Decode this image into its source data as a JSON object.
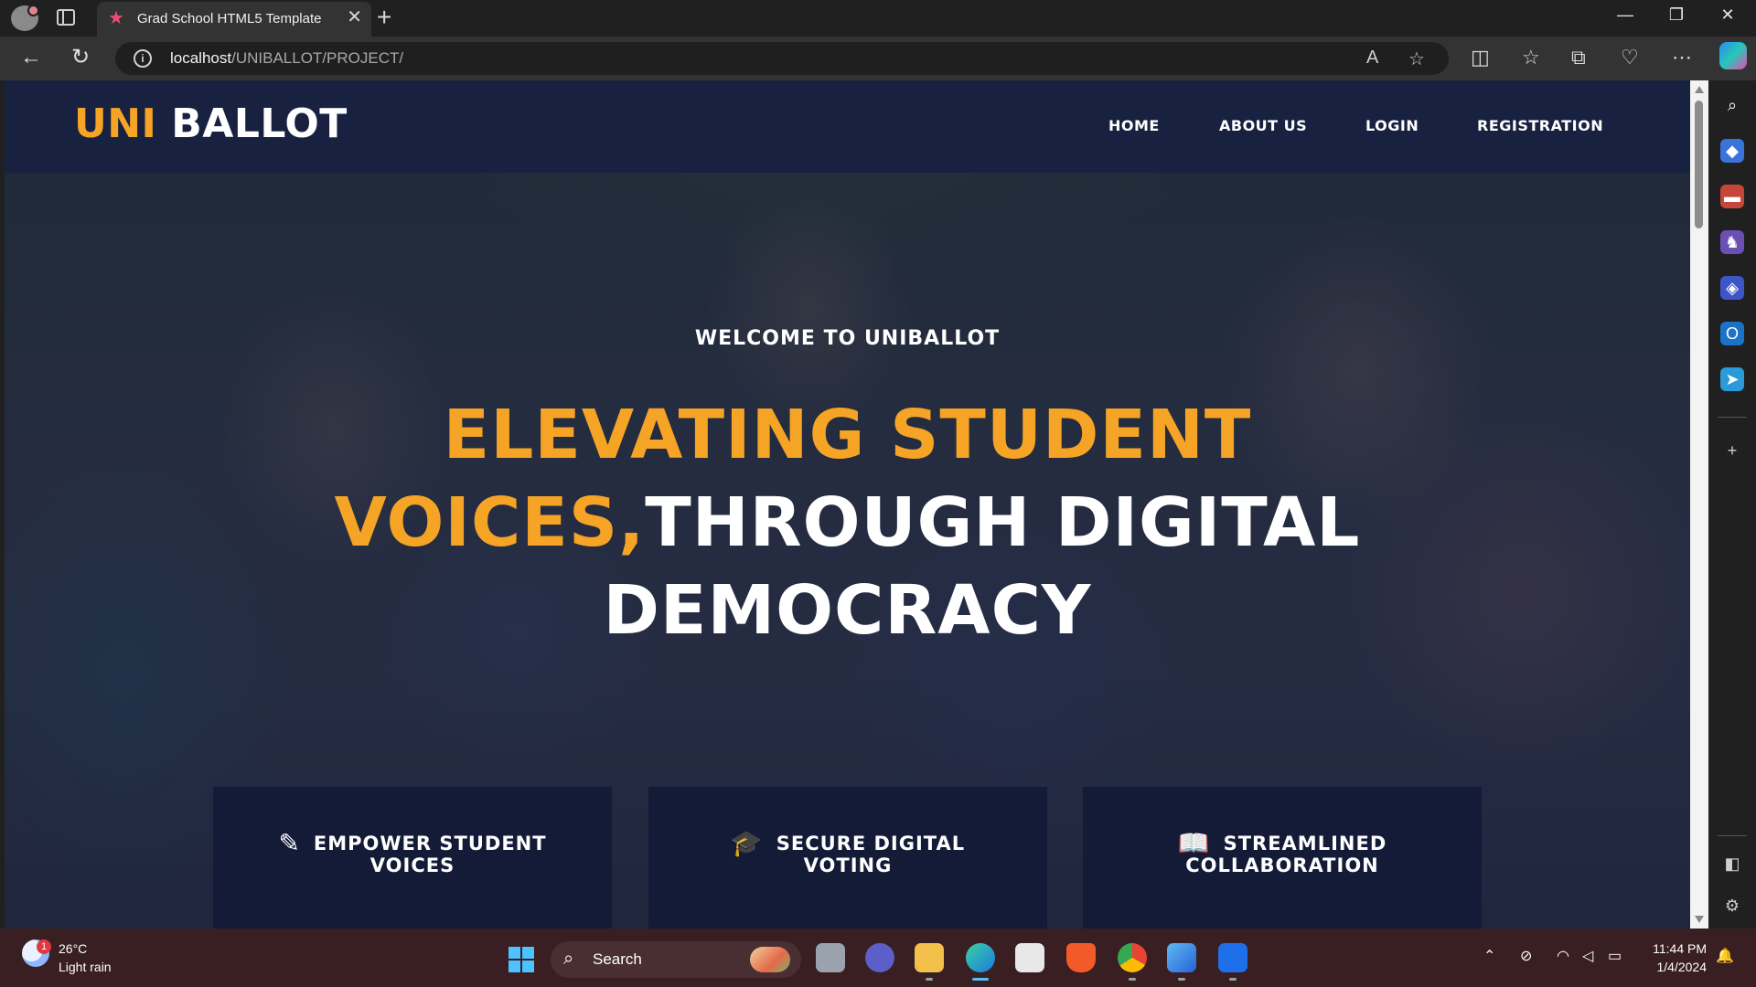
{
  "browser": {
    "tab_title": "Grad School HTML5 Template",
    "url_host": "localhost",
    "url_path": "/UNIBALLOT/PROJECT/"
  },
  "site": {
    "logo_part1": "UNI",
    "logo_part2": "BALLOT",
    "nav": [
      "HOME",
      "ABOUT US",
      "LOGIN",
      "REGISTRATION"
    ],
    "welcome": "WELCOME TO UNIBALLOT",
    "headline_orange_1": "ELEVATING STUDENT",
    "headline_orange_2": "VOICES,",
    "headline_white_1": "THROUGH DIGITAL",
    "headline_white_2": "DEMOCRACY",
    "features": [
      {
        "icon": "pencil-icon",
        "line1": "EMPOWER STUDENT",
        "line2": "VOICES"
      },
      {
        "icon": "graduation-cap-icon",
        "line1": "SECURE DIGITAL",
        "line2": "VOTING"
      },
      {
        "icon": "book-icon",
        "line1": "STREAMLINED",
        "line2": "COLLABORATION"
      }
    ],
    "colors": {
      "accent": "#f5a425",
      "header_bg": "#182240",
      "feature_bg": "#131b36"
    }
  },
  "taskbar": {
    "weather_badge": "1",
    "temperature": "26°C",
    "weather": "Light rain",
    "search_placeholder": "Search",
    "time": "11:44 PM",
    "date": "1/4/2024"
  }
}
